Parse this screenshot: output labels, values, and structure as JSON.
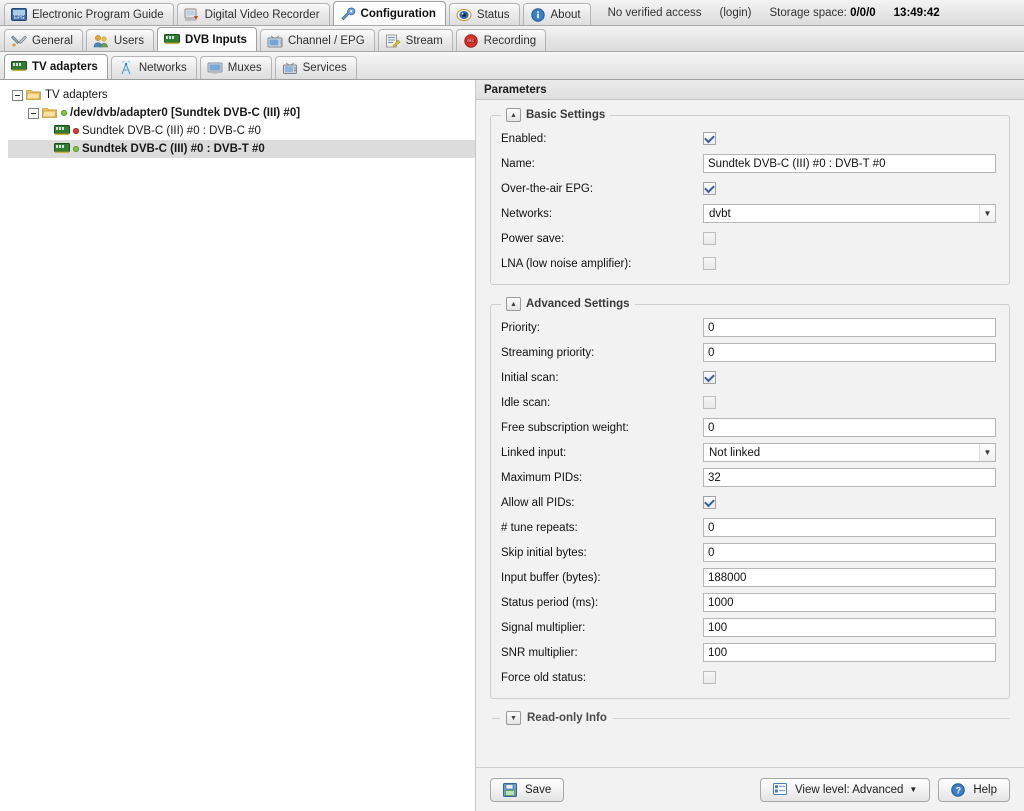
{
  "app": {
    "main_tabs": [
      {
        "label": "Electronic Program Guide",
        "icon": "epg-icon",
        "active": false
      },
      {
        "label": "Digital Video Recorder",
        "icon": "dvr-icon",
        "active": false
      },
      {
        "label": "Configuration",
        "icon": "wrench-icon",
        "active": true
      },
      {
        "label": "Status",
        "icon": "eye-icon",
        "active": false
      },
      {
        "label": "About",
        "icon": "info-icon",
        "active": false
      }
    ],
    "status": {
      "access": "No verified access",
      "login": "(login)",
      "storage_label": "Storage space:",
      "storage_value": "0/0/0",
      "clock": "13:49:42"
    },
    "config_tabs": [
      {
        "label": "General",
        "icon": "tools-icon",
        "active": false
      },
      {
        "label": "Users",
        "icon": "users-icon",
        "active": false
      },
      {
        "label": "DVB Inputs",
        "icon": "card-icon",
        "active": true
      },
      {
        "label": "Channel / EPG",
        "icon": "tv-icon",
        "active": false
      },
      {
        "label": "Stream",
        "icon": "stream-icon",
        "active": false
      },
      {
        "label": "Recording",
        "icon": "rec-icon",
        "active": false
      }
    ],
    "sub_tabs": [
      {
        "label": "TV adapters",
        "icon": "card-icon",
        "active": true
      },
      {
        "label": "Networks",
        "icon": "antenna-icon",
        "active": false
      },
      {
        "label": "Muxes",
        "icon": "monitor-icon",
        "active": false
      },
      {
        "label": "Services",
        "icon": "tv-small-icon",
        "active": false
      }
    ]
  },
  "tree": {
    "root": {
      "label": "TV adapters"
    },
    "adapter": {
      "label": "/dev/dvb/adapter0 [Sundtek DVB-C (III) #0]",
      "status": "green"
    },
    "children": [
      {
        "label": "Sundtek DVB-C (III) #0 : DVB-C #0",
        "status": "red",
        "selected": false
      },
      {
        "label": "Sundtek DVB-C (III) #0 : DVB-T #0",
        "status": "green",
        "selected": true
      }
    ]
  },
  "parameters": {
    "title": "Parameters",
    "basic": {
      "legend": "Basic Settings",
      "fields": [
        {
          "label": "Enabled:",
          "type": "checkbox",
          "checked": true,
          "name": "enabled"
        },
        {
          "label": "Name:",
          "type": "text",
          "value": "Sundtek DVB-C (III) #0 : DVB-T #0",
          "name": "name"
        },
        {
          "label": "Over-the-air EPG:",
          "type": "checkbox",
          "checked": true,
          "name": "over-the-air-epg"
        },
        {
          "label": "Networks:",
          "type": "select",
          "value": "dvbt",
          "name": "networks"
        },
        {
          "label": "Power save:",
          "type": "checkbox",
          "checked": false,
          "name": "power-save"
        },
        {
          "label": "LNA (low noise amplifier):",
          "type": "checkbox",
          "checked": false,
          "name": "lna"
        }
      ]
    },
    "advanced": {
      "legend": "Advanced Settings",
      "fields": [
        {
          "label": "Priority:",
          "type": "text",
          "value": "0",
          "name": "priority"
        },
        {
          "label": "Streaming priority:",
          "type": "text",
          "value": "0",
          "name": "streaming-priority"
        },
        {
          "label": "Initial scan:",
          "type": "checkbox",
          "checked": true,
          "name": "initial-scan"
        },
        {
          "label": "Idle scan:",
          "type": "checkbox",
          "checked": false,
          "name": "idle-scan"
        },
        {
          "label": "Free subscription weight:",
          "type": "text",
          "value": "0",
          "name": "free-subscription-weight"
        },
        {
          "label": "Linked input:",
          "type": "select",
          "value": "Not linked",
          "name": "linked-input"
        },
        {
          "label": "Maximum PIDs:",
          "type": "text",
          "value": "32",
          "name": "maximum-pids"
        },
        {
          "label": "Allow all PIDs:",
          "type": "checkbox",
          "checked": true,
          "name": "allow-all-pids"
        },
        {
          "label": "# tune repeats:",
          "type": "text",
          "value": "0",
          "name": "tune-repeats"
        },
        {
          "label": "Skip initial bytes:",
          "type": "text",
          "value": "0",
          "name": "skip-initial-bytes"
        },
        {
          "label": "Input buffer (bytes):",
          "type": "text",
          "value": "188000",
          "name": "input-buffer"
        },
        {
          "label": "Status period (ms):",
          "type": "text",
          "value": "1000",
          "name": "status-period"
        },
        {
          "label": "Signal multiplier:",
          "type": "text",
          "value": "100",
          "name": "signal-multiplier"
        },
        {
          "label": "SNR multiplier:",
          "type": "text",
          "value": "100",
          "name": "snr-multiplier"
        },
        {
          "label": "Force old status:",
          "type": "checkbox",
          "checked": false,
          "name": "force-old-status"
        }
      ]
    },
    "readonly": {
      "legend": "Read-only Info",
      "collapsed": true
    }
  },
  "footer": {
    "save": "Save",
    "view_level": "View level: Advanced",
    "help": "Help"
  },
  "colors": {
    "accent_blue": "#3a5f9e",
    "ok_green": "#7ac943",
    "error_red": "#e03a3a",
    "panel_bg": "#f2f2f2",
    "selection": "#dcdcdc"
  }
}
